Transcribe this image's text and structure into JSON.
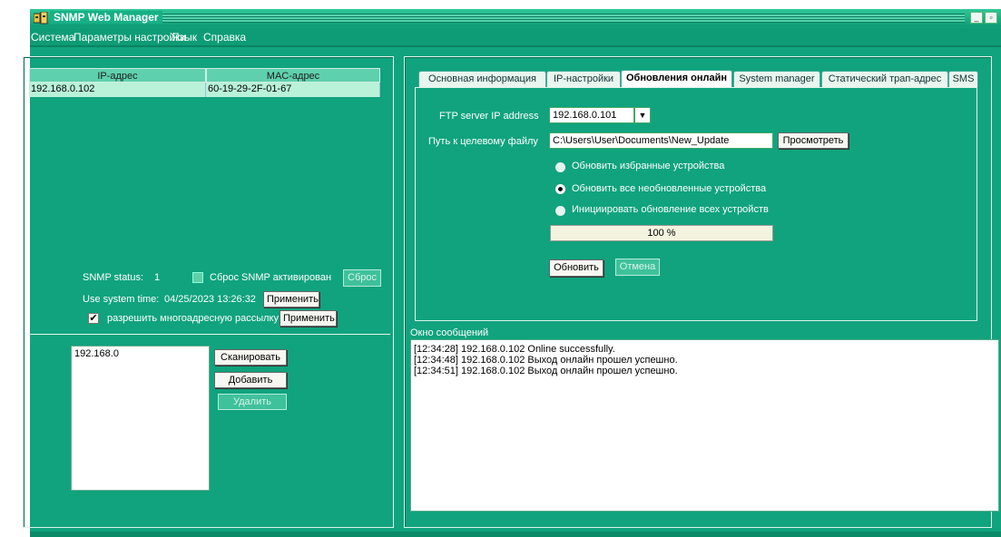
{
  "window": {
    "title": "SNMP Web Manager"
  },
  "menu": [
    "Система",
    "Параметры настройки",
    "Язык",
    "Справка"
  ],
  "device_table": {
    "headers": [
      "IP-адрес",
      "MAC-адрес"
    ],
    "rows": [
      [
        "192.168.0.102",
        "60-19-29-2F-01-67"
      ]
    ]
  },
  "snmp": {
    "status_label": "SNMP status:",
    "status_value": "1",
    "reset_check_label": "Сброс SNMP активирован",
    "reset_button": "Сброс",
    "system_time_label": "Use system time:",
    "system_time_value": "04/25/2023 13:26:32",
    "apply_button": "Применить",
    "multicast_label": "разрешить многоадресную рассылку",
    "multicast_apply": "Применить"
  },
  "scan": {
    "list_value": "192.168.0",
    "scan_button": "Сканировать",
    "add_button": "Добавить",
    "delete_button": "Удалить"
  },
  "tabs": [
    "Основная информация",
    "IP-настройки",
    "Обновления онлайн",
    "System manager",
    "Статический трап-адрес",
    "SMS"
  ],
  "active_tab": "Обновления онлайн",
  "update": {
    "ftp_label": "FTP server IP address",
    "ftp_value": "192.168.0.101",
    "path_label": "Путь к целевому файлу",
    "path_value": "C:\\Users\\User\\Documents\\New_Update",
    "browse_button": "Просмотреть",
    "options": [
      "Обновить избранные устройства",
      "Обновить все необновленные устройства",
      "Инициировать обновление всех устройств"
    ],
    "selected_option": 1,
    "progress_text": "100 %",
    "progress": 1.0,
    "update_button": "Обновить",
    "cancel_button": "Отмена"
  },
  "messages": {
    "label": "Окно сообщений",
    "lines": [
      "[12:34:28]  192.168.0.102 Online successfully.",
      "[12:34:48]  192.168.0.102 Выход онлайн прошел успешно.",
      "[12:34:51]  192.168.0.102 Выход онлайн прошел успешно."
    ]
  },
  "colors": {
    "window_bg": "#10a37e",
    "row_highlight": "#b9f2d9",
    "header": "#5fd0ad"
  }
}
